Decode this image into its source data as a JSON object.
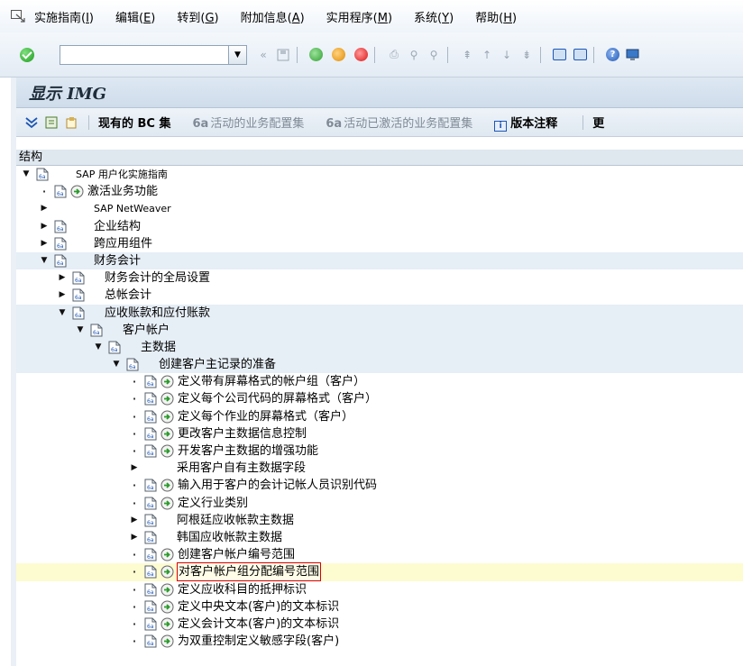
{
  "menubar": {
    "items": [
      {
        "label": "实施指南(",
        "key": "I",
        "end": ")"
      },
      {
        "label": "编辑(",
        "key": "E",
        "end": ")"
      },
      {
        "label": "转到(",
        "key": "G",
        "end": ")"
      },
      {
        "label": "附加信息(",
        "key": "A",
        "end": ")"
      },
      {
        "label": "实用程序(",
        "key": "M",
        "end": ")"
      },
      {
        "label": "系统(",
        "key": "Y",
        "end": ")"
      },
      {
        "label": "帮助(",
        "key": "H",
        "end": ")"
      }
    ]
  },
  "toolbar": {
    "command_field_value": "",
    "history": "«"
  },
  "title": "显示 IMG",
  "app_toolbar": {
    "bc_sets": "现有的 BC 集",
    "active_bc_sets": "活动的业务配置集",
    "activated_bc_sets": "活动已激活的业务配置集",
    "release_notes": "版本注释",
    "more": "更"
  },
  "tree": {
    "header": "结构",
    "rows": [
      {
        "level": 0,
        "arrow": "down",
        "doc": true,
        "exec": false,
        "label": "SAP 用户化实施指南",
        "small": true,
        "band": false
      },
      {
        "level": 1,
        "arrow": "dot",
        "doc": true,
        "exec": true,
        "label": "激活业务功能",
        "band": false
      },
      {
        "level": 1,
        "arrow": "right",
        "doc": false,
        "exec": false,
        "label": "SAP NetWeaver",
        "small": true,
        "band": false
      },
      {
        "level": 1,
        "arrow": "right",
        "doc": true,
        "exec": false,
        "label": "企业结构",
        "band": false
      },
      {
        "level": 1,
        "arrow": "right",
        "doc": true,
        "exec": false,
        "label": "跨应用组件",
        "band": false
      },
      {
        "level": 1,
        "arrow": "down",
        "doc": true,
        "exec": false,
        "label": "财务会计",
        "band": true
      },
      {
        "level": 2,
        "arrow": "right",
        "doc": true,
        "exec": false,
        "label": "财务会计的全局设置",
        "band": false
      },
      {
        "level": 2,
        "arrow": "right",
        "doc": true,
        "exec": false,
        "label": "总帐会计",
        "band": false
      },
      {
        "level": 2,
        "arrow": "down",
        "doc": true,
        "exec": false,
        "label": "应收账款和应付账款",
        "band": true
      },
      {
        "level": 3,
        "arrow": "down",
        "doc": true,
        "exec": false,
        "label": "客户帐户",
        "band": true
      },
      {
        "level": 4,
        "arrow": "down",
        "doc": true,
        "exec": false,
        "label": "主数据",
        "band": true
      },
      {
        "level": 5,
        "arrow": "down",
        "doc": true,
        "exec": false,
        "label": "创建客户主记录的准备",
        "band": true
      },
      {
        "level": 6,
        "arrow": "dot",
        "doc": true,
        "exec": true,
        "label": "定义带有屏幕格式的帐户组（客户）"
      },
      {
        "level": 6,
        "arrow": "dot",
        "doc": true,
        "exec": true,
        "label": "定义每个公司代码的屏幕格式（客户）"
      },
      {
        "level": 6,
        "arrow": "dot",
        "doc": true,
        "exec": true,
        "label": "定义每个作业的屏幕格式（客户）"
      },
      {
        "level": 6,
        "arrow": "dot",
        "doc": true,
        "exec": true,
        "label": "更改客户主数据信息控制"
      },
      {
        "level": 6,
        "arrow": "dot",
        "doc": true,
        "exec": true,
        "label": "开发客户主数据的增强功能"
      },
      {
        "level": 6,
        "arrow": "right",
        "doc": false,
        "exec": false,
        "label": "采用客户自有主数据字段"
      },
      {
        "level": 6,
        "arrow": "dot",
        "doc": true,
        "exec": true,
        "label": "输入用于客户的会计记帐人员识别代码"
      },
      {
        "level": 6,
        "arrow": "dot",
        "doc": true,
        "exec": true,
        "label": "定义行业类别"
      },
      {
        "level": 6,
        "arrow": "right",
        "doc": true,
        "exec": false,
        "label": "阿根廷应收帐款主数据"
      },
      {
        "level": 6,
        "arrow": "right",
        "doc": true,
        "exec": false,
        "label": "韩国应收帐款主数据"
      },
      {
        "level": 6,
        "arrow": "dot",
        "doc": true,
        "exec": true,
        "label": "创建客户帐户编号范围"
      },
      {
        "level": 6,
        "arrow": "dot",
        "doc": true,
        "exec": true,
        "label": "对客户帐户组分配编号范围",
        "highlight": true
      },
      {
        "level": 6,
        "arrow": "dot",
        "doc": true,
        "exec": true,
        "label": "定义应收科目的抵押标识"
      },
      {
        "level": 6,
        "arrow": "dot",
        "doc": true,
        "exec": true,
        "label": "定义中央文本(客户)的文本标识"
      },
      {
        "level": 6,
        "arrow": "dot",
        "doc": true,
        "exec": true,
        "label": "定义会计文本(客户)的文本标识"
      },
      {
        "level": 6,
        "arrow": "dot",
        "doc": true,
        "exec": true,
        "label": "为双重控制定义敏感字段(客户)"
      }
    ]
  }
}
